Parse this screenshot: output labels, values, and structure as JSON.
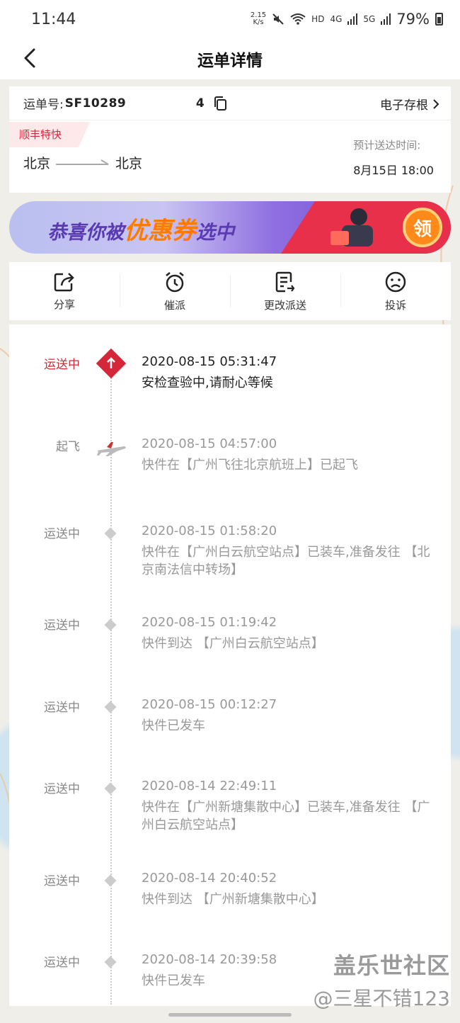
{
  "status_bar": {
    "time": "11:44",
    "net_speed_top": "2.15",
    "net_speed_bottom": "K/s",
    "hd": "HD",
    "sig1": "4G",
    "sig2": "5G",
    "battery": "79%"
  },
  "header": {
    "title": "运单详情"
  },
  "waybill": {
    "label": "运单号:",
    "number": "SF10289        4",
    "stub_label": "电子存根",
    "service_tag": "顺丰特快",
    "from": "北京",
    "to": "北京",
    "eta_label": "预计送达时间:",
    "eta_value": "8月15日 18:00"
  },
  "banner": {
    "text_pre": "恭喜你被",
    "text_highlight": "优惠券",
    "text_post": "选中",
    "button": "领"
  },
  "actions": [
    {
      "label": "分享",
      "icon": "share-icon"
    },
    {
      "label": "催派",
      "icon": "alarm-clock-icon"
    },
    {
      "label": "更改派送",
      "icon": "edit-delivery-icon"
    },
    {
      "label": "投诉",
      "icon": "complaint-face-icon"
    }
  ],
  "timeline": [
    {
      "status": "运送中",
      "time": "2020-08-15 05:31:47",
      "desc": "安检查验中,请耐心等候",
      "marker": "up-arrow-diamond-icon",
      "active": true
    },
    {
      "status": "起飞",
      "time": "2020-08-15 04:57:00",
      "desc": "快件在【广州飞往北京航班上】已起飞",
      "marker": "airplane-icon",
      "active": false
    },
    {
      "status": "运送中",
      "time": "2020-08-15 01:58:20",
      "desc": "快件在【广州白云航空站点】已装车,准备发往 【北京南法信中转场】",
      "marker": "diamond-icon",
      "active": false
    },
    {
      "status": "运送中",
      "time": "2020-08-15 01:19:42",
      "desc": "快件到达 【广州白云航空站点】",
      "marker": "diamond-icon",
      "active": false
    },
    {
      "status": "运送中",
      "time": "2020-08-15 00:12:27",
      "desc": "快件已发车",
      "marker": "diamond-icon",
      "active": false
    },
    {
      "status": "运送中",
      "time": "2020-08-14 22:49:11",
      "desc": "快件在【广州新塘集散中心】已装车,准备发往 【广州白云航空站点】",
      "marker": "diamond-icon",
      "active": false
    },
    {
      "status": "运送中",
      "time": "2020-08-14 20:40:52",
      "desc": "快件到达 【广州新塘集散中心】",
      "marker": "diamond-icon",
      "active": false
    },
    {
      "status": "运送中",
      "time": "2020-08-14 20:39:58",
      "desc": "快件已发车",
      "marker": "diamond-icon",
      "active": false
    }
  ],
  "watermark": {
    "line1": "盖乐世社区",
    "line2": "@三星不错123"
  },
  "colors": {
    "accent_red": "#d4283a",
    "muted_text": "#999999"
  }
}
